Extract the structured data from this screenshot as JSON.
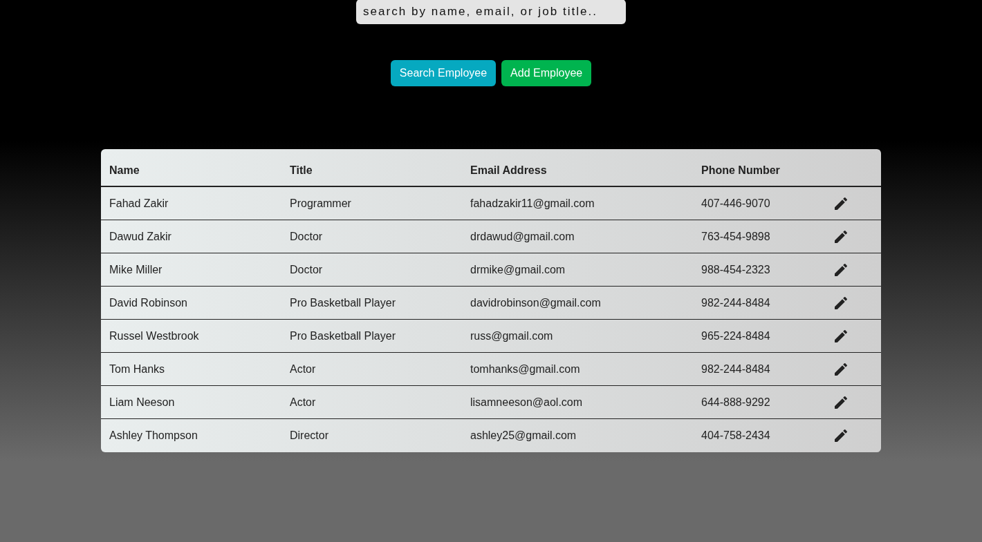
{
  "search": {
    "placeholder": "search by name, email, or job title.."
  },
  "buttons": [
    {
      "label": "Search Employee",
      "kind": "search"
    },
    {
      "label": "Add Employee",
      "kind": "add"
    }
  ],
  "table": {
    "columns": [
      "Name",
      "Title",
      "Email Address",
      "Phone Number"
    ],
    "rows": [
      {
        "cells": [
          "Fahad Zakir",
          "Programmer",
          "fahadzakir11@gmail.com",
          "407-446-9070"
        ]
      },
      {
        "cells": [
          "Dawud Zakir",
          "Doctor",
          "drdawud@gmail.com",
          "763-454-9898"
        ]
      },
      {
        "cells": [
          "Mike Miller",
          "Doctor",
          "drmike@gmail.com",
          "988-454-2323"
        ]
      },
      {
        "cells": [
          "David Robinson",
          "Pro Basketball Player",
          "davidrobinson@gmail.com",
          "982-244-8484"
        ]
      },
      {
        "cells": [
          "Russel Westbrook",
          "Pro Basketball Player",
          "russ@gmail.com",
          "965-224-8484"
        ]
      },
      {
        "cells": [
          "Tom Hanks",
          "Actor",
          "tomhanks@gmail.com",
          "982-244-8484"
        ]
      },
      {
        "cells": [
          "Liam Neeson",
          "Actor",
          "lisamneeson@aol.com",
          "644-888-9292"
        ]
      },
      {
        "cells": [
          "Ashley Thompson",
          "Director",
          "ashley25@gmail.com",
          "404-758-2434"
        ]
      }
    ]
  }
}
